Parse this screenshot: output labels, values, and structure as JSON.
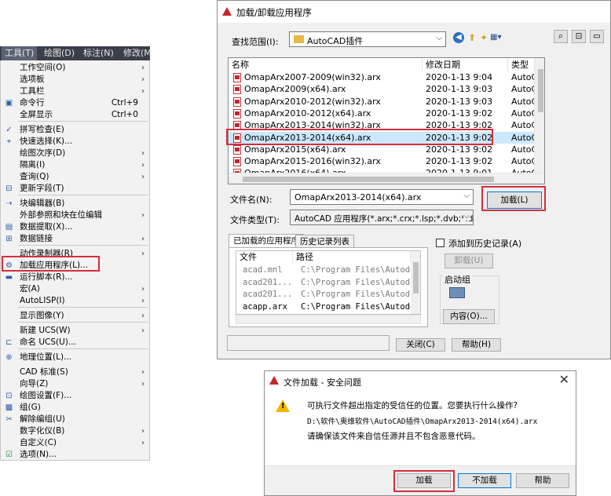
{
  "menubar": {
    "items": [
      "工具(T)",
      "绘图(D)",
      "标注(N)",
      "修改(M"
    ]
  },
  "menu": {
    "items": [
      {
        "label": "工作空间(O)",
        "shortcut": "",
        "arrow": true
      },
      {
        "label": "选项板",
        "shortcut": "",
        "arrow": true
      },
      {
        "label": "工具栏",
        "shortcut": "",
        "arrow": true
      },
      {
        "label": "命令行",
        "shortcut": "Ctrl+9",
        "arrow": false
      },
      {
        "label": "全屏显示",
        "shortcut": "Ctrl+0",
        "arrow": false
      },
      {
        "label": "拼写检查(E)",
        "shortcut": "",
        "arrow": false
      },
      {
        "label": "快速选择(K)...",
        "shortcut": "",
        "arrow": false
      },
      {
        "label": "绘图次序(D)",
        "shortcut": "",
        "arrow": true
      },
      {
        "label": "隔离(I)",
        "shortcut": "",
        "arrow": true
      },
      {
        "label": "查询(Q)",
        "shortcut": "",
        "arrow": true
      },
      {
        "label": "更新字段(T)",
        "shortcut": "",
        "arrow": false
      },
      {
        "label": "块编辑器(B)",
        "shortcut": "",
        "arrow": false
      },
      {
        "label": "外部参照和块在位编辑",
        "shortcut": "",
        "arrow": true
      },
      {
        "label": "数据提取(X)...",
        "shortcut": "",
        "arrow": false
      },
      {
        "label": "数据链接",
        "shortcut": "",
        "arrow": true
      },
      {
        "label": "动作录制器(R)",
        "shortcut": "",
        "arrow": true
      },
      {
        "label": "加载应用程序(L)...",
        "shortcut": "",
        "arrow": false
      },
      {
        "label": "运行脚本(R)...",
        "shortcut": "",
        "arrow": false
      },
      {
        "label": "宏(A)",
        "shortcut": "",
        "arrow": true
      },
      {
        "label": "AutoLISP(I)",
        "shortcut": "",
        "arrow": true
      },
      {
        "label": "显示图像(Y)",
        "shortcut": "",
        "arrow": true
      },
      {
        "label": "新建 UCS(W)",
        "shortcut": "",
        "arrow": true
      },
      {
        "label": "命名 UCS(U)...",
        "shortcut": "",
        "arrow": false
      },
      {
        "label": "地理位置(L)...",
        "shortcut": "",
        "arrow": false
      },
      {
        "label": "CAD 标准(S)",
        "shortcut": "",
        "arrow": true
      },
      {
        "label": "向导(Z)",
        "shortcut": "",
        "arrow": true
      },
      {
        "label": "绘图设置(F)...",
        "shortcut": "",
        "arrow": false
      },
      {
        "label": "组(G)",
        "shortcut": "",
        "arrow": false
      },
      {
        "label": "解除编组(U)",
        "shortcut": "",
        "arrow": false
      },
      {
        "label": "数字化仪(B)",
        "shortcut": "",
        "arrow": true
      },
      {
        "label": "自定义(C)",
        "shortcut": "",
        "arrow": true
      },
      {
        "label": "选项(N)...",
        "shortcut": "",
        "arrow": false
      }
    ]
  },
  "load_dialog": {
    "title": "加载/卸载应用程序",
    "lookin_label": "查找范围(I):",
    "lookin_value": "AutoCAD插件",
    "columns": [
      "名称",
      "修改日期",
      "类型"
    ],
    "files": [
      {
        "name": "OmapArx2007-2009(win32).arx",
        "date": "2020-1-13 9:04",
        "type": "AutoC/"
      },
      {
        "name": "OmapArx2009(x64).arx",
        "date": "2020-1-13 9:03",
        "type": "AutoC/"
      },
      {
        "name": "OmapArx2010-2012(win32).arx",
        "date": "2020-1-13 9:03",
        "type": "AutoC/"
      },
      {
        "name": "OmapArx2010-2012(x64).arx",
        "date": "2020-1-13 9:02",
        "type": "AutoC/"
      },
      {
        "name": "OmapArx2013-2014(win32).arx",
        "date": "2020-1-13 9:02",
        "type": "AutoC/"
      },
      {
        "name": "OmapArx2013-2014(x64).arx",
        "date": "2020-1-13 9:02",
        "type": "AutoC/"
      },
      {
        "name": "OmapArx2015(x64).arx",
        "date": "2020-1-13 9:02",
        "type": "AutoC/"
      },
      {
        "name": "OmapArx2015-2016(win32).arx",
        "date": "2020-1-13 9:02",
        "type": "AutoC/"
      },
      {
        "name": "OmapArx2016(x64).arx",
        "date": "2020-1-13 9:01",
        "type": "AutoC/"
      }
    ],
    "filename_label": "文件名(N):",
    "filename_value": "OmapArx2013-2014(x64).arx",
    "filetype_label": "文件类型(T):",
    "filetype_value": "AutoCAD 应用程序(*.arx;*.crx;*.lsp;*.dvb;*.dbx;",
    "load_button": "加载(L)",
    "tabs": [
      "已加载的应用程序",
      "历史记录列表"
    ],
    "loaded_columns": [
      "文件",
      "路径"
    ],
    "loaded": [
      {
        "file": "acad.mnl",
        "path": "C:\\Program Files\\Autodesk..."
      },
      {
        "file": "acad201...",
        "path": "C:\\Program Files\\Autodesk..."
      },
      {
        "file": "acad201...",
        "path": "C:\\Program Files\\Autodesk..."
      },
      {
        "file": "acapp.arx",
        "path": "C:\\Program Files\\Autodesk..."
      }
    ],
    "add_history_label": "添加到历史记录(A)",
    "unload_button": "卸载(U)",
    "startup_group_label": "启动组",
    "contents_button": "内容(O)...",
    "close_button": "关闭(C)",
    "help_button": "帮助(H)"
  },
  "warn_dialog": {
    "title": "文件加载 - 安全问题",
    "message": "可执行文件超出指定的受信任的位置。您要执行什么操作?",
    "path": "D:\\软件\\奥维软件\\AutoCAD插件\\OmapArx2013-2014(x64).arx",
    "note": "请确保该文件来自信任源并且不包含恶意代码。",
    "load_button": "加载",
    "noload_button": "不加载",
    "help_button": "帮助"
  },
  "colors": {
    "highlight_red": "#d62d3a",
    "selection_blue": "#cce8ff",
    "menubar_dark": "#3a3f49"
  }
}
